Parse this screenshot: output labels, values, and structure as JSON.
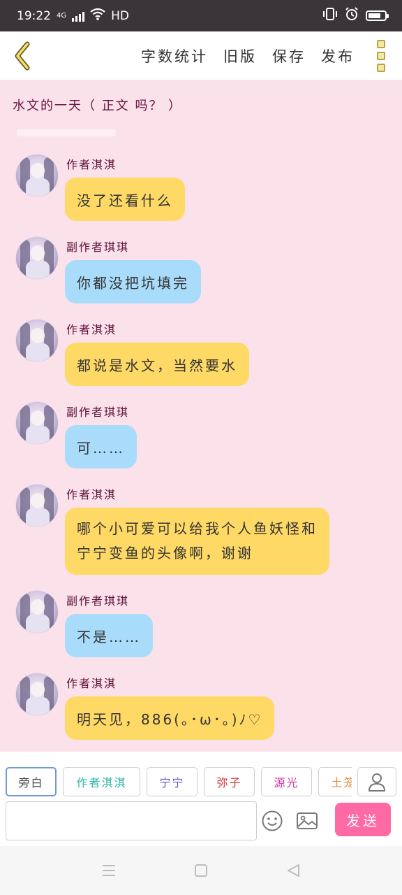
{
  "status_bar": {
    "time": "19:22",
    "network": "4G",
    "hd": "HD"
  },
  "toolbar": {
    "actions": [
      "字数统计",
      "旧版",
      "保存",
      "发布"
    ]
  },
  "doc": {
    "title": "水文的一天（ 正文 吗？ ）"
  },
  "messages": [
    {
      "sender": "作者淇淇",
      "lines": [
        "没了还看什么"
      ],
      "color": "yellow"
    },
    {
      "sender": "副作者琪琪",
      "lines": [
        "你都没把坑填完"
      ],
      "color": "blue"
    },
    {
      "sender": "作者淇淇",
      "lines": [
        "都说是水文，当然要水"
      ],
      "color": "yellow"
    },
    {
      "sender": "副作者琪琪",
      "lines": [
        "可……"
      ],
      "color": "blue"
    },
    {
      "sender": "作者淇淇",
      "lines": [
        "哪个小可爱可以给我个人鱼妖怪和",
        "宁宁变鱼的头像啊，谢谢"
      ],
      "color": "yellow"
    },
    {
      "sender": "副作者琪琪",
      "lines": [
        "不是……"
      ],
      "color": "blue"
    },
    {
      "sender": "作者淇淇",
      "lines": [
        "明天见，886(｡･ω･｡)ﾉ♡"
      ],
      "color": "yellow"
    }
  ],
  "roles": [
    {
      "label": "旁白",
      "color": "#444444"
    },
    {
      "label": "作者淇淇",
      "color": "#2bb7a8"
    },
    {
      "label": "宁宁",
      "color": "#6a52c9"
    },
    {
      "label": "弥子",
      "color": "#d03a3a"
    },
    {
      "label": "源光",
      "color": "#d0379b"
    },
    {
      "label": "土笼",
      "color": "#e98a3e"
    }
  ],
  "input": {
    "value": "",
    "send_label": "发送"
  },
  "colors": {
    "content_bg": "#fbe1ea",
    "bubble_yellow": "#ffd966",
    "bubble_blue": "#a9dcfb",
    "send_button": "#ff69a4",
    "status_bar": "#3a3538"
  }
}
